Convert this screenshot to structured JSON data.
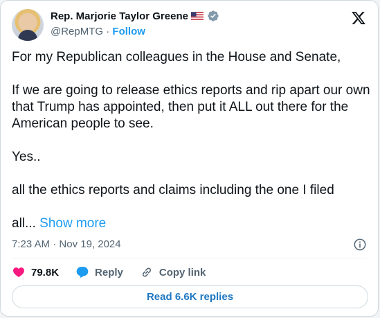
{
  "author": {
    "name": "Rep. Marjorie Taylor Greene",
    "handle": "@RepMTG",
    "separator": "·",
    "follow_label": "Follow",
    "flag_icon": "us-flag-icon",
    "verified_icon": "verified-badge-icon",
    "verified_color": "#829aab"
  },
  "brand": {
    "logo_icon": "x-logo-icon"
  },
  "tweet": {
    "paragraphs": [
      "For my Republican colleagues in the House and Senate,",
      "If we are going to release ethics reports and rip apart our own that Trump has appointed, then put it ALL out there for the American people to see.",
      "Yes..",
      "all the ethics reports and claims including the one I filed"
    ],
    "truncated_start": "all...",
    "show_more_label": "Show more"
  },
  "meta": {
    "time": "7:23 AM",
    "separator": "·",
    "date": "Nov 19, 2024",
    "info_icon": "info-icon"
  },
  "actions": {
    "like_count": "79.8K",
    "like_color": "#f91880",
    "reply_label": "Reply",
    "reply_color": "#1d9bf0",
    "copy_label": "Copy link"
  },
  "replies_button": {
    "label": "Read 6.6K replies"
  },
  "colors": {
    "accent": "#1d9bf0",
    "secondary_text": "#536471",
    "border": "#cfd9de"
  }
}
